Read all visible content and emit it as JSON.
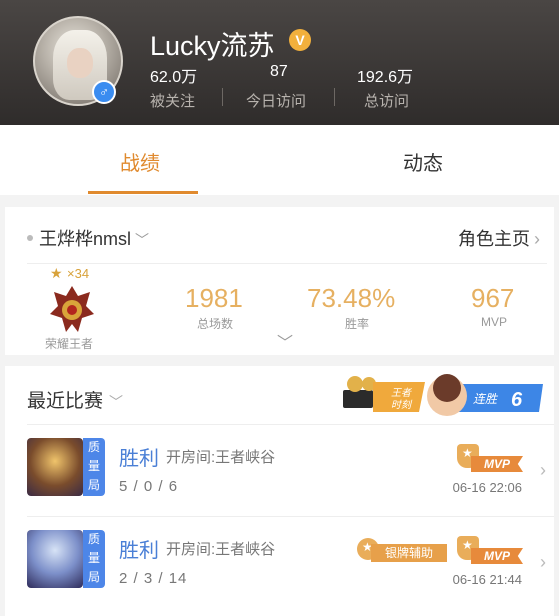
{
  "profile": {
    "username": "Lucky流苏",
    "verified_icon": "verified-v-icon",
    "verified_text": "V",
    "gender_icon": "male-icon",
    "gender_text": "♂",
    "stats": [
      {
        "value": "62.0万",
        "label": "被关注"
      },
      {
        "value": "87",
        "label": "今日访问"
      },
      {
        "value": "192.6万",
        "label": "总访问"
      }
    ]
  },
  "tabs": [
    {
      "label": "战绩",
      "active": true
    },
    {
      "label": "动态",
      "active": false
    }
  ],
  "role": {
    "name": "王烨桦nmsl",
    "home_link": "角色主页",
    "rank_stars": "×34",
    "rank_name": "荣耀王者",
    "stats": [
      {
        "value": "1981",
        "label": "总场数"
      },
      {
        "value": "73.48%",
        "label": "胜率"
      },
      {
        "value": "967",
        "label": "MVP"
      }
    ]
  },
  "matches": {
    "title": "最近比赛",
    "promo": {
      "app_label": "王者\n时刻",
      "streak_label": "连胜",
      "streak_count": "6"
    },
    "items": [
      {
        "mode_tag": "质量局",
        "result": "胜利",
        "room": "开房间:王者峡谷",
        "kda": "5 / 0 / 6",
        "time": "06-16 22:06",
        "badges": [
          "MVP"
        ]
      },
      {
        "mode_tag": "质量局",
        "result": "胜利",
        "room": "开房间:王者峡谷",
        "kda": "2 / 3 / 14",
        "time": "06-16 21:44",
        "badges": [
          "银牌辅助",
          "MVP"
        ]
      }
    ]
  },
  "colors": {
    "accent": "#e08a2e",
    "win_blue": "#4a7fd6",
    "stat_gold": "#e6b061",
    "mode_tag_blue": "#4d86e8"
  }
}
